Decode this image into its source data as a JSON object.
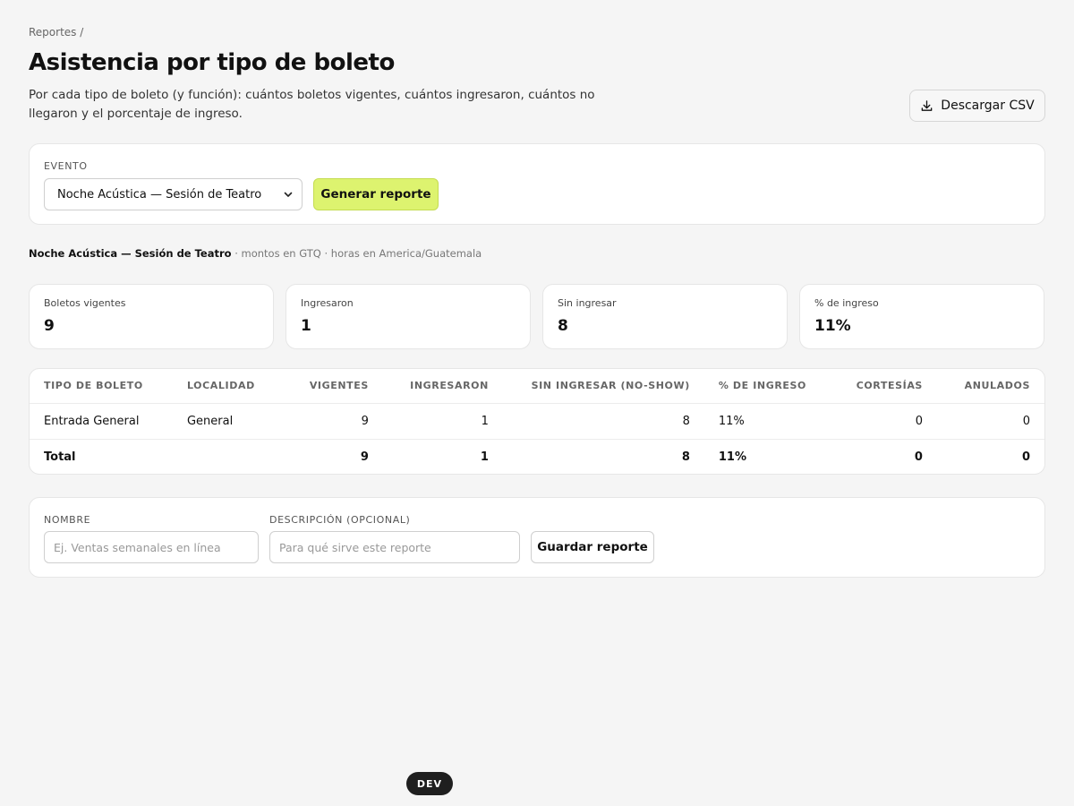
{
  "breadcrumb": "Reportes /",
  "title": "Asistencia por tipo de boleto",
  "description": "Por cada tipo de boleto (y función): cuántos boletos vigentes, cuántos ingresaron, cuántos no llegaron y el porcentaje de ingreso.",
  "download_button": {
    "label": "Descargar CSV",
    "icon": "download-icon"
  },
  "filter": {
    "event_label": "EVENTO",
    "event_selected": "Noche Acústica — Sesión de Teatro",
    "generate_label": "Generar reporte"
  },
  "meta": {
    "event_name": "Noche Acústica — Sesión de Teatro",
    "details": " · montos en GTQ · horas en America/Guatemala"
  },
  "kpis": [
    {
      "label": "Boletos vigentes",
      "value": "9"
    },
    {
      "label": "Ingresaron",
      "value": "1"
    },
    {
      "label": "Sin ingresar",
      "value": "8"
    },
    {
      "label": "% de ingreso",
      "value": "11%"
    }
  ],
  "table": {
    "headers": [
      "TIPO DE BOLETO",
      "LOCALIDAD",
      "VIGENTES",
      "INGRESARON",
      "SIN INGRESAR (NO-SHOW)",
      "% DE INGRESO",
      "CORTESÍAS",
      "ANULADOS"
    ],
    "rows": [
      [
        "Entrada General",
        "General",
        "9",
        "1",
        "8",
        "11%",
        "0",
        "0"
      ]
    ],
    "total": [
      "Total",
      "",
      "9",
      "1",
      "8",
      "11%",
      "0",
      "0"
    ]
  },
  "save": {
    "name_label": "NOMBRE",
    "name_placeholder": "Ej. Ventas semanales en línea",
    "desc_label": "DESCRIPCIÓN (OPCIONAL)",
    "desc_placeholder": "Para qué sirve este reporte",
    "save_label": "Guardar reporte"
  },
  "dev_badge": "DEV",
  "colors": {
    "accent": "#ddf36f",
    "background": "#f5f5f5",
    "dark_badge": "#1f1f1f"
  }
}
